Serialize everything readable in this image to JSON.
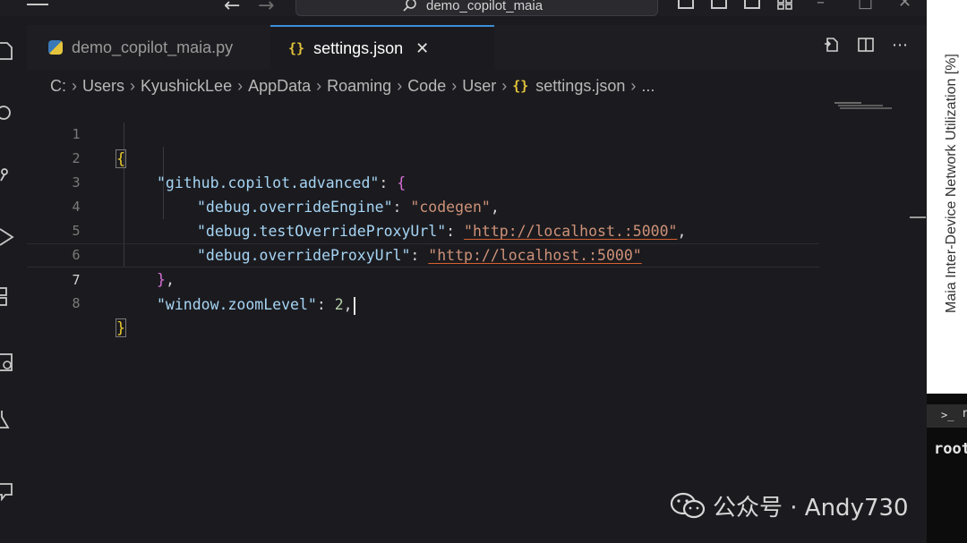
{
  "titlebar": {
    "search_text": "demo_copilot_maia"
  },
  "tabs": [
    {
      "label": "demo_copilot_maia.py",
      "icon": "python-file-icon",
      "active": false
    },
    {
      "label": "settings.json",
      "icon": "json-braces-icon",
      "icon_text": "{}",
      "active": true,
      "close": "✕"
    }
  ],
  "breadcrumb": {
    "parts": [
      "C:",
      "Users",
      "KyushickLee",
      "AppData",
      "Roaming",
      "Code",
      "User"
    ],
    "file_icon": "{}",
    "file": "settings.json",
    "more": "..."
  },
  "editor": {
    "active_line": 7,
    "lines": [
      {
        "n": "1",
        "text": "{"
      },
      {
        "n": "2",
        "text": "\"github.copilot.advanced\": {"
      },
      {
        "n": "3",
        "text": "\"debug.overrideEngine\": \"codegen\","
      },
      {
        "n": "4",
        "text": "\"debug.testOverrideProxyUrl\": \"http://localhost.:5000\","
      },
      {
        "n": "5",
        "text": "\"debug.overrideProxyUrl\": \"http://localhost.:5000\""
      },
      {
        "n": "6",
        "text": "},"
      },
      {
        "n": "7",
        "text": "\"window.zoomLevel\": 2,"
      },
      {
        "n": "8",
        "text": "}"
      }
    ],
    "tokens": {
      "k1": "\"github.copilot.advanced\"",
      "k2": "\"debug.overrideEngine\"",
      "v2": "\"codegen\"",
      "k3": "\"debug.testOverrideProxyUrl\"",
      "v3": "\"http://localhost.:5000\"",
      "k4": "\"debug.overrideProxyUrl\"",
      "v4": "\"http://localhost.:5000\"",
      "k5": "\"window.zoomLevel\"",
      "v5": "2"
    }
  },
  "right_panel": {
    "chart_title": "Maia Inter-Device Network Utilization [%]",
    "terminal_tab_letter": "r",
    "terminal_text": "root"
  },
  "watermark": {
    "text": "公众号 · Andy730"
  },
  "colors": {
    "accent_tab": "#3c8fd8",
    "json_key": "#a6d5f5",
    "json_string": "#ce9178",
    "json_number": "#b5cea8",
    "bracket_level1": "#f0d030",
    "bracket_level2": "#d76fd6",
    "link_underline": "#d66030"
  }
}
